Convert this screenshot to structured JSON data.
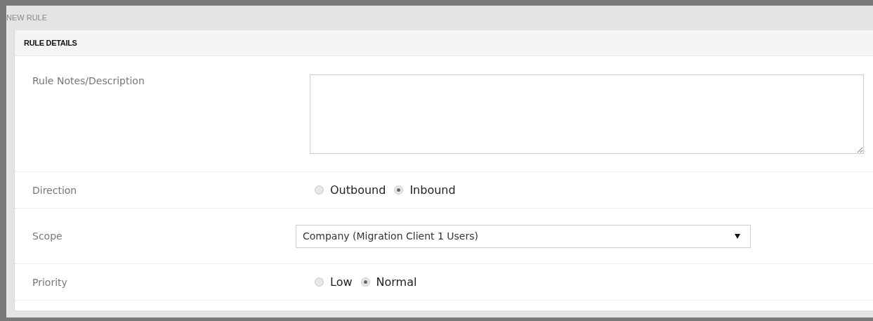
{
  "window": {
    "title": "NEW RULE"
  },
  "section": {
    "title": "RULE DETAILS"
  },
  "rows": [
    {
      "kind": "textarea",
      "label": "Rule Notes/Description"
    },
    {
      "kind": "radio",
      "label": "Direction",
      "options": [
        {
          "label": "Outbound",
          "selected": false
        },
        {
          "label": "Inbound",
          "selected": true
        }
      ]
    },
    {
      "kind": "select",
      "label": "Scope",
      "value": "Company (Migration Client 1 Users)"
    },
    {
      "kind": "radio",
      "label": "Priority",
      "options": [
        {
          "label": "Low",
          "selected": false
        },
        {
          "label": "Normal",
          "selected": true
        }
      ]
    }
  ]
}
